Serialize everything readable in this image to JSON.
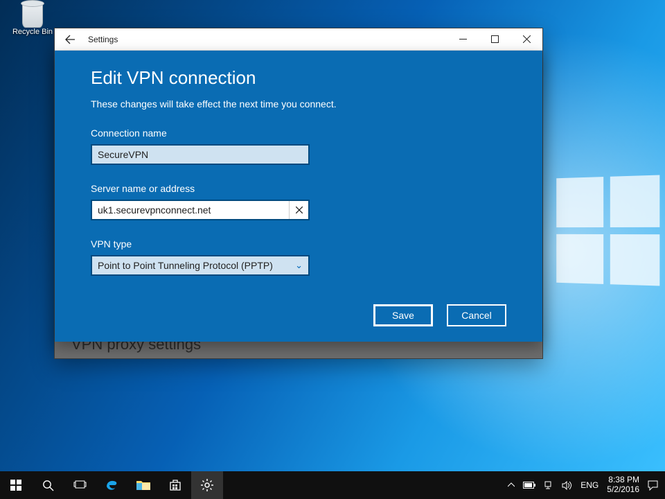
{
  "desktop": {
    "recycle_bin_label": "Recycle Bin"
  },
  "window": {
    "title": "Settings",
    "hidden_setting_label": "VPN proxy settings"
  },
  "modal": {
    "heading": "Edit VPN connection",
    "sub": "These changes will take effect the next time you connect.",
    "conn_label": "Connection name",
    "conn_value": "SecureVPN",
    "server_label": "Server name or address",
    "server_value": "uk1.securevpnconnect.net",
    "type_label": "VPN type",
    "type_value": "Point to Point Tunneling Protocol (PPTP)",
    "save": "Save",
    "cancel": "Cancel"
  },
  "taskbar": {
    "lang": "ENG",
    "time": "8:38 PM",
    "date": "5/2/2016"
  }
}
